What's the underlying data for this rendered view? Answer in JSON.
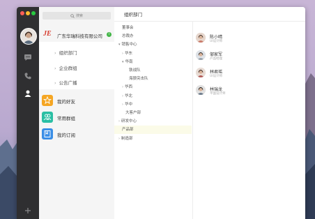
{
  "window": {
    "traffic_lights": [
      "#ff5f57",
      "#febc2e",
      "#28c840"
    ]
  },
  "rail": {
    "icons": [
      "chat-bubble-icon",
      "phone-icon",
      "contacts-icon",
      "plus-icon"
    ]
  },
  "search": {
    "placeholder": "搜索",
    "icon": "search-icon"
  },
  "company": {
    "logo_text": "JE",
    "name": "广东华瑞科技有限公司",
    "badge": "i"
  },
  "company_items": [
    {
      "label": "组织部门"
    },
    {
      "label": "企业群组"
    },
    {
      "label": "公告广播"
    }
  ],
  "apps": [
    {
      "label": "我的好友",
      "icon": "star-icon",
      "color": "#f5a623"
    },
    {
      "label": "常用群组",
      "icon": "group-icon",
      "color": "#2bbfa4"
    },
    {
      "label": "我的订阅",
      "icon": "bookmark-icon",
      "color": "#3a8ee6"
    }
  ],
  "main": {
    "title": "组织部门"
  },
  "tree": [
    {
      "label": "董事会",
      "level": 0,
      "arrow": ""
    },
    {
      "label": "总裁办",
      "level": 0,
      "arrow": ""
    },
    {
      "label": "销售中心",
      "level": 0,
      "arrow": "▾"
    },
    {
      "label": "华东",
      "level": 1,
      "arrow": "›"
    },
    {
      "label": "华南",
      "level": 1,
      "arrow": "▾"
    },
    {
      "label": "铁战队",
      "level": 2,
      "arrow": ""
    },
    {
      "label": "海狼突击队",
      "level": 2,
      "arrow": ""
    },
    {
      "label": "华西",
      "level": 1,
      "arrow": "›"
    },
    {
      "label": "华北",
      "level": 1,
      "arrow": "›"
    },
    {
      "label": "华中",
      "level": 1,
      "arrow": "›"
    },
    {
      "label": "大客户部",
      "level": 1,
      "arrow": ""
    },
    {
      "label": "研发中心",
      "level": 0,
      "arrow": "›"
    },
    {
      "label": "产品部",
      "level": 0,
      "arrow": ""
    },
    {
      "label": "制造部",
      "level": 0,
      "arrow": "›"
    }
  ],
  "tree_selected_index": 12,
  "people": [
    {
      "name": "陈小晴",
      "title": "UI设计师"
    },
    {
      "name": "邹家军",
      "title": "产品经理"
    },
    {
      "name": "林君瑶",
      "title": "UI设计师"
    },
    {
      "name": "林瑞龙",
      "title": "平面设计师"
    }
  ]
}
